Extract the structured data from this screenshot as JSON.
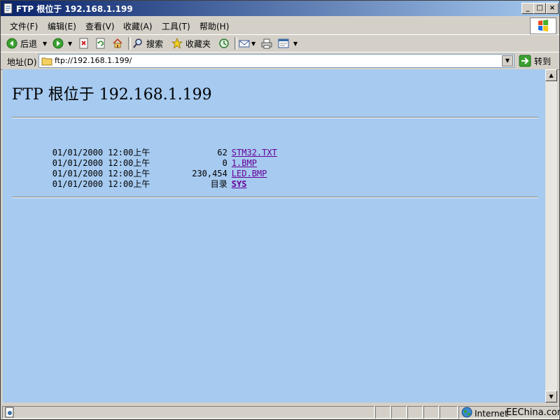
{
  "window": {
    "title": "FTP 根位于 192.168.1.199",
    "min_label": "_",
    "max_label": "□",
    "close_label": "×"
  },
  "menu": {
    "items": [
      "文件(F)",
      "编辑(E)",
      "查看(V)",
      "收藏(A)",
      "工具(T)",
      "帮助(H)"
    ]
  },
  "toolbar": {
    "back_label": "后退",
    "search_label": "搜索",
    "favorites_label": "收藏夹"
  },
  "address": {
    "label": "地址(D)",
    "value": "ftp://192.168.1.199/",
    "go_label": "转到"
  },
  "page": {
    "heading": "FTP 根位于 192.168.1.199",
    "entries": [
      {
        "date": "01/01/2000 12:00上午",
        "size": "62",
        "name": "STM32.TXT"
      },
      {
        "date": "01/01/2000 12:00上午",
        "size": "0",
        "name": "1.BMP"
      },
      {
        "date": "01/01/2000 12:00上午",
        "size": "230,454",
        "name": "LED.BMP"
      },
      {
        "date": "01/01/2000 12:00上午",
        "size": "目录",
        "name": "SYS"
      }
    ]
  },
  "status": {
    "zone_label": "Internet",
    "watermark": "EEChina.com"
  },
  "colors": {
    "content_bg": "#a6caf0",
    "link_color": "#660099",
    "title_bar": "#0a246a"
  }
}
